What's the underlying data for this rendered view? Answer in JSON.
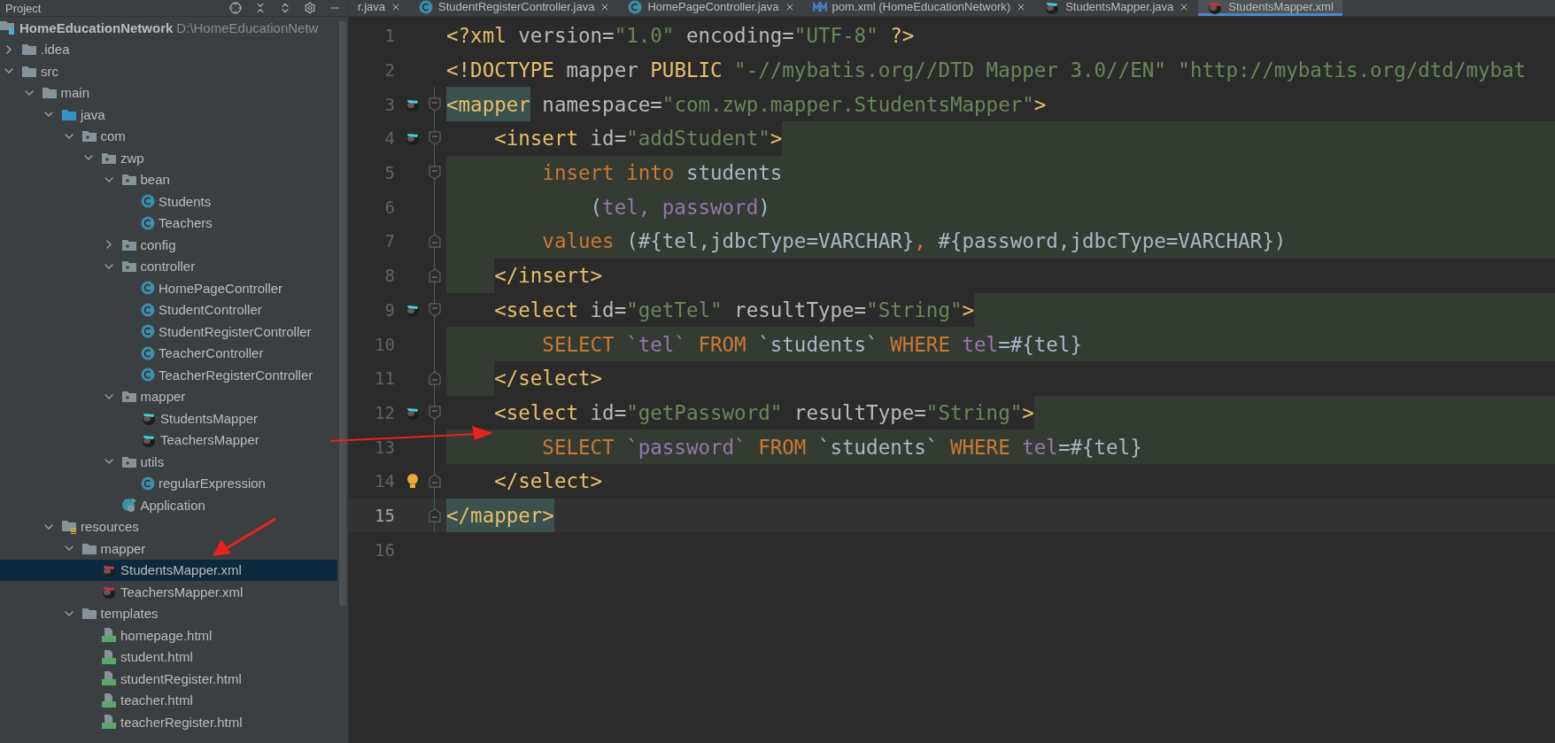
{
  "tool_window": {
    "title": "Project"
  },
  "project_root": {
    "name": "HomeEducationNetwork",
    "path": "D:\\HomeEducationNetw"
  },
  "tree": [
    {
      "name": ".idea",
      "kind": "folder",
      "expanded": false,
      "selected": false
    },
    {
      "name": "src",
      "kind": "folder",
      "expanded": true,
      "selected": false,
      "children": [
        {
          "name": "main",
          "kind": "folder",
          "expanded": true,
          "selected": false,
          "children": [
            {
              "name": "java",
              "kind": "source_root",
              "expanded": true,
              "selected": false,
              "children": [
                {
                  "name": "com",
                  "kind": "package",
                  "expanded": true,
                  "selected": false,
                  "children": [
                    {
                      "name": "zwp",
                      "kind": "package",
                      "expanded": true,
                      "selected": false,
                      "children": [
                        {
                          "name": "bean",
                          "kind": "package",
                          "expanded": true,
                          "selected": false,
                          "children": [
                            {
                              "name": "Students",
                              "kind": "class",
                              "selected": false
                            },
                            {
                              "name": "Teachers",
                              "kind": "class",
                              "selected": false
                            }
                          ]
                        },
                        {
                          "name": "config",
                          "kind": "package",
                          "expanded": false,
                          "selected": false
                        },
                        {
                          "name": "controller",
                          "kind": "package",
                          "expanded": true,
                          "selected": false,
                          "children": [
                            {
                              "name": "HomePageController",
                              "kind": "class",
                              "selected": false
                            },
                            {
                              "name": "StudentController",
                              "kind": "class",
                              "selected": false
                            },
                            {
                              "name": "StudentRegisterController",
                              "kind": "class",
                              "selected": false
                            },
                            {
                              "name": "TeacherController",
                              "kind": "class",
                              "selected": false
                            },
                            {
                              "name": "TeacherRegisterController",
                              "kind": "class",
                              "selected": false
                            }
                          ]
                        },
                        {
                          "name": "mapper",
                          "kind": "package",
                          "expanded": true,
                          "selected": false,
                          "children": [
                            {
                              "name": "StudentsMapper",
                              "kind": "mybatis",
                              "selected": false
                            },
                            {
                              "name": "TeachersMapper",
                              "kind": "mybatis",
                              "selected": false
                            }
                          ]
                        },
                        {
                          "name": "utils",
                          "kind": "package",
                          "expanded": true,
                          "selected": false,
                          "children": [
                            {
                              "name": "regularExpression",
                              "kind": "class",
                              "selected": false
                            }
                          ]
                        },
                        {
                          "name": "Application",
                          "kind": "app",
                          "selected": false
                        }
                      ]
                    }
                  ]
                }
              ]
            },
            {
              "name": "resources",
              "kind": "resources",
              "expanded": true,
              "selected": false,
              "children": [
                {
                  "name": "mapper",
                  "kind": "folder",
                  "expanded": true,
                  "selected": false,
                  "children": [
                    {
                      "name": "StudentsMapper.xml",
                      "kind": "mybatis_xml",
                      "selected": true
                    },
                    {
                      "name": "TeachersMapper.xml",
                      "kind": "mybatis_xml",
                      "selected": false
                    }
                  ]
                },
                {
                  "name": "templates",
                  "kind": "folder",
                  "expanded": true,
                  "selected": false,
                  "children": [
                    {
                      "name": "homepage.html",
                      "kind": "html",
                      "selected": false
                    },
                    {
                      "name": "student.html",
                      "kind": "html",
                      "selected": false
                    },
                    {
                      "name": "studentRegister.html",
                      "kind": "html",
                      "selected": false
                    },
                    {
                      "name": "teacher.html",
                      "kind": "html",
                      "selected": false
                    },
                    {
                      "name": "teacherRegister.html",
                      "kind": "html",
                      "selected": false
                    }
                  ]
                }
              ]
            }
          ]
        }
      ]
    }
  ],
  "tabs": [
    {
      "label": "r.java",
      "kind": "plain",
      "selected": false
    },
    {
      "label": "StudentRegisterController.java",
      "kind": "class",
      "selected": false
    },
    {
      "label": "HomePageController.java",
      "kind": "class",
      "selected": false
    },
    {
      "label": "pom.xml (HomeEducationNetwork)",
      "kind": "maven",
      "selected": false
    },
    {
      "label": "StudentsMapper.java",
      "kind": "mybatis",
      "selected": false
    },
    {
      "label": "StudentsMapper.xml",
      "kind": "mybatis_xml",
      "selected": true
    }
  ],
  "code_lines": [
    {
      "number": "1",
      "current": false,
      "segments": [
        {
          "kind": "tag",
          "text": "<?xml"
        },
        {
          "kind": "attr",
          "text": " version="
        },
        {
          "kind": "string",
          "text": "\"1.0\""
        },
        {
          "kind": "attr",
          "text": " encoding="
        },
        {
          "kind": "string",
          "text": "\"UTF-8\""
        },
        {
          "kind": "tag",
          "text": " ?>"
        }
      ]
    },
    {
      "number": "2",
      "current": false,
      "segments": [
        {
          "kind": "tag",
          "text": "<!DOCTYPE"
        },
        {
          "kind": "attr",
          "text": " mapper "
        },
        {
          "kind": "tag",
          "text": "PUBLIC"
        },
        {
          "kind": "string",
          "text": " \"-//mybatis.org//DTD Mapper 3.0//EN\" \"http://mybatis.org/dtd/mybat"
        }
      ]
    },
    {
      "number": "3",
      "current": false,
      "marker": {
        "kind": "mybatis"
      },
      "fold": {
        "kind": "start"
      },
      "segments": [
        {
          "kind": "tag",
          "text": "<mapper",
          "matched": true
        },
        {
          "kind": "attr",
          "text": " namespace="
        },
        {
          "kind": "string",
          "text": "\"com.zwp.mapper.StudentsMapper\""
        },
        {
          "kind": "tag",
          "text": ">"
        }
      ],
      "children": [
        {
          "number": "4",
          "current": false,
          "marker": {
            "kind": "mybatis"
          },
          "fold": {
            "kind": "start"
          },
          "shade": {
            "kind": "after"
          },
          "segments": [
            {
              "kind": "tag",
              "text": "<insert"
            },
            {
              "kind": "attr",
              "text": " id="
            },
            {
              "kind": "string",
              "text": "\"addStudent\""
            },
            {
              "kind": "tag",
              "text": ">"
            }
          ],
          "children": [
            {
              "number": "5",
              "current": false,
              "fold": {
                "kind": "start"
              },
              "shade": {
                "kind": "full"
              },
              "segments": [
                {
                  "kind": "keyword",
                  "text": "insert into"
                },
                {
                  "kind": "text",
                  "text": " students"
                }
              ],
              "children": [
                {
                  "number": "6",
                  "current": false,
                  "shade": {
                    "kind": "full"
                  },
                  "segments": [
                    {
                      "kind": "text",
                      "text": "("
                    },
                    {
                      "kind": "field",
                      "text": "tel, password"
                    },
                    {
                      "kind": "text",
                      "text": ")"
                    }
                  ]
                }
              ]
            },
            {
              "number": "7",
              "current": false,
              "fold": {
                "kind": "end"
              },
              "shade": {
                "kind": "full"
              },
              "segments": [
                {
                  "kind": "keyword",
                  "text": "values"
                },
                {
                  "kind": "text",
                  "text": " (#{tel,jdbcType=VARCHAR}"
                },
                {
                  "kind": "keyword",
                  "text": ","
                },
                {
                  "kind": "text",
                  "text": " #{password,jdbcType=VARCHAR})"
                }
              ]
            }
          ]
        },
        {
          "number": "8",
          "current": false,
          "fold": {
            "kind": "end"
          },
          "shade": {
            "kind": "before"
          },
          "segments": [
            {
              "kind": "tag",
              "text": "</insert>"
            }
          ]
        },
        {
          "number": "9",
          "current": false,
          "marker": {
            "kind": "mybatis"
          },
          "fold": {
            "kind": "start"
          },
          "shade": {
            "kind": "after"
          },
          "segments": [
            {
              "kind": "tag",
              "text": "<select"
            },
            {
              "kind": "attr",
              "text": " id="
            },
            {
              "kind": "string",
              "text": "\"getTel\""
            },
            {
              "kind": "attr",
              "text": " resultType="
            },
            {
              "kind": "string",
              "text": "\"String\""
            },
            {
              "kind": "tag",
              "text": ">"
            }
          ],
          "children": [
            {
              "number": "10",
              "current": false,
              "shade": {
                "kind": "full"
              },
              "segments": [
                {
                  "kind": "keyword",
                  "text": "SELECT"
                },
                {
                  "kind": "field",
                  "text": " `tel`"
                },
                {
                  "kind": "keyword",
                  "text": " FROM"
                },
                {
                  "kind": "text",
                  "text": " `students`"
                },
                {
                  "kind": "keyword",
                  "text": " WHERE"
                },
                {
                  "kind": "field",
                  "text": " tel"
                },
                {
                  "kind": "text",
                  "text": "=#{tel}"
                }
              ]
            }
          ]
        },
        {
          "number": "11",
          "current": false,
          "fold": {
            "kind": "end"
          },
          "shade": {
            "kind": "before"
          },
          "segments": [
            {
              "kind": "tag",
              "text": "</select>"
            }
          ]
        },
        {
          "number": "12",
          "current": false,
          "marker": {
            "kind": "mybatis"
          },
          "fold": {
            "kind": "start"
          },
          "shade": {
            "kind": "after"
          },
          "segments": [
            {
              "kind": "tag",
              "text": "<select"
            },
            {
              "kind": "attr",
              "text": " id="
            },
            {
              "kind": "string",
              "text": "\"getPassword\""
            },
            {
              "kind": "attr",
              "text": " resultType="
            },
            {
              "kind": "string",
              "text": "\"String\""
            },
            {
              "kind": "tag",
              "text": ">"
            }
          ],
          "children": [
            {
              "number": "13",
              "current": false,
              "shade": {
                "kind": "full"
              },
              "segments": [
                {
                  "kind": "keyword",
                  "text": "SELECT"
                },
                {
                  "kind": "field",
                  "text": " `password`"
                },
                {
                  "kind": "keyword",
                  "text": " FROM"
                },
                {
                  "kind": "text",
                  "text": " `students`"
                },
                {
                  "kind": "keyword",
                  "text": " WHERE"
                },
                {
                  "kind": "field",
                  "text": " tel"
                },
                {
                  "kind": "text",
                  "text": "=#{tel}"
                }
              ]
            }
          ]
        },
        {
          "number": "14",
          "current": false,
          "marker": {
            "kind": "bulb"
          },
          "fold": {
            "kind": "end"
          },
          "segments": [
            {
              "kind": "tag",
              "text": "</select>"
            }
          ]
        }
      ]
    },
    {
      "number": "15",
      "current": true,
      "fold": {
        "kind": "end"
      },
      "segments": [
        {
          "kind": "tag",
          "text": "</mapper>",
          "matched": true
        }
      ]
    },
    {
      "number": "16",
      "current": false
    }
  ]
}
